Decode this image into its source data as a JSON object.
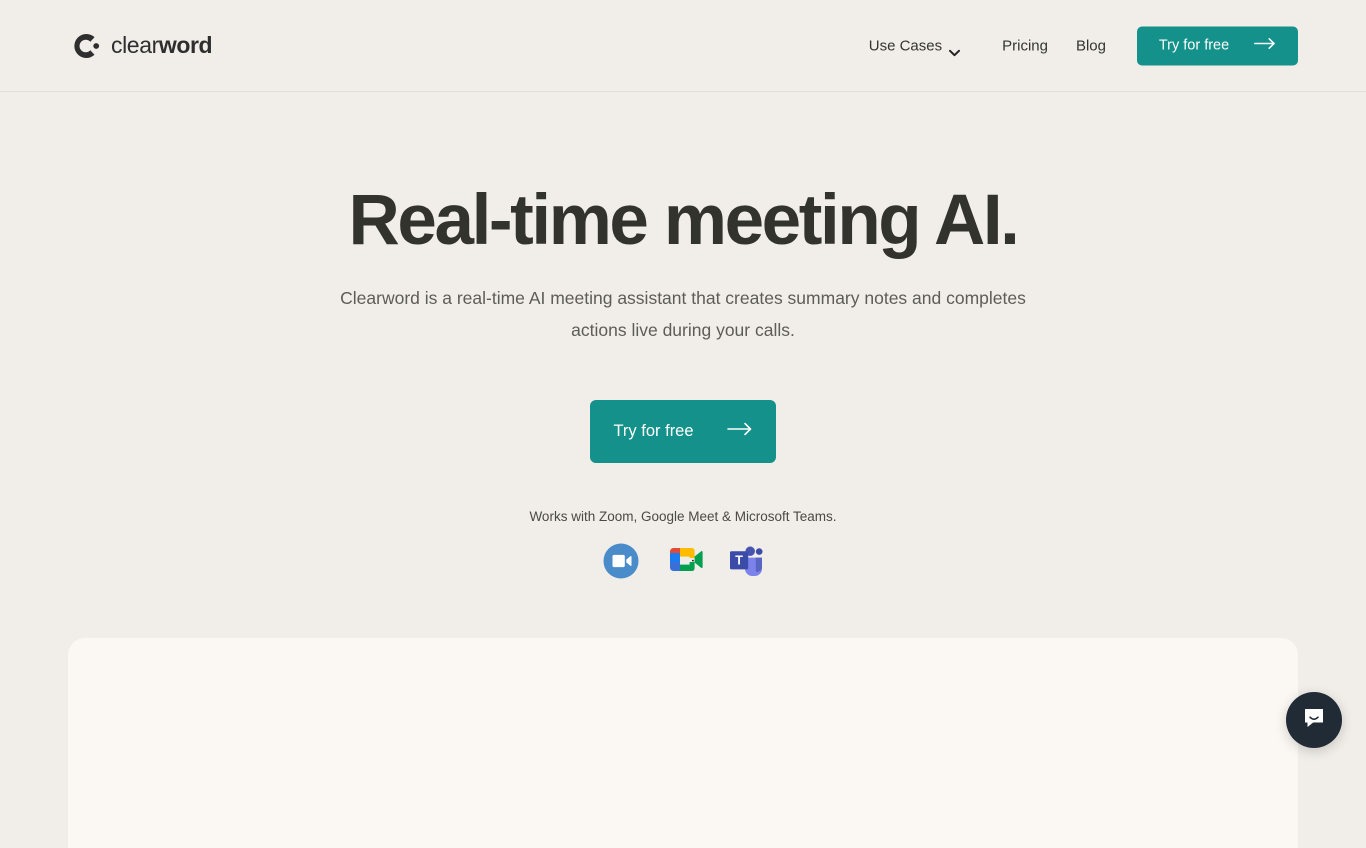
{
  "colors": {
    "page_bg": "#F1EEE9",
    "accent_teal": "#14918A",
    "heading": "#33332E",
    "body_text": "#5E5C56",
    "panel_bg": "#FBF8F3",
    "intercom_bg": "#212B36",
    "zoom_blue": "#4A8CCA",
    "meet_green": "#00A04E",
    "meet_blue": "#1B7CF0",
    "meet_red": "#E04A36",
    "meet_yellow": "#FFBB00",
    "teams_dark": "#3B4BA8",
    "teams_light": "#7B83EB"
  },
  "header": {
    "logo": {
      "icon": "clearword-c-mark-icon",
      "text_light": "clear",
      "text_bold": "word"
    },
    "nav": [
      {
        "label": "Use Cases",
        "icon": "chevron-down-icon",
        "has_dropdown": true
      },
      {
        "label": "Pricing",
        "has_dropdown": false
      },
      {
        "label": "Blog",
        "has_dropdown": false
      }
    ],
    "cta": {
      "label": "Try for free",
      "icon": "arrow-right-icon"
    }
  },
  "hero": {
    "headline": "Real-time meeting AI.",
    "subtitle": "Clearword is a real-time AI meeting assistant that creates summary notes and completes actions live during your calls.",
    "cta": {
      "label": "Try for free",
      "icon": "arrow-right-icon"
    },
    "works_with": "Works with Zoom, Google Meet & Microsoft Teams.",
    "integrations": [
      {
        "name": "Zoom",
        "icon": "zoom-icon"
      },
      {
        "name": "Google Meet",
        "icon": "google-meet-icon"
      },
      {
        "name": "Microsoft Teams",
        "icon": "microsoft-teams-icon"
      }
    ]
  },
  "widgets": {
    "intercom": {
      "label": "Open chat",
      "icon": "chat-bubble-smile-icon"
    }
  }
}
